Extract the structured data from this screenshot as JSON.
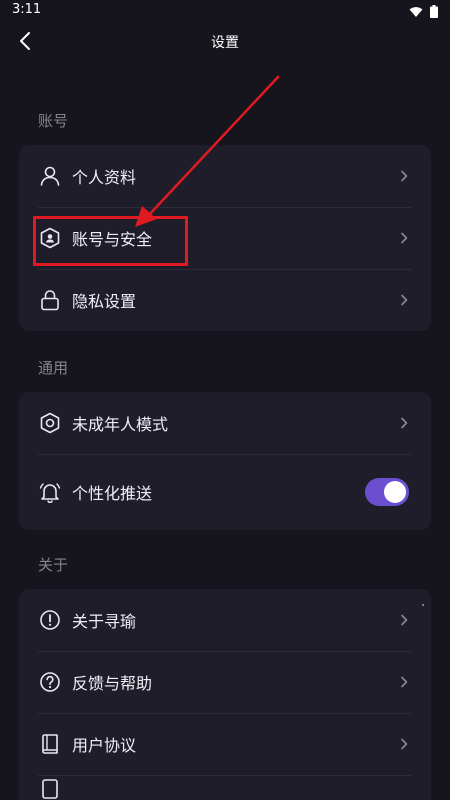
{
  "status_bar": {
    "time": "3:11"
  },
  "header": {
    "title": "设置"
  },
  "sections": {
    "account": {
      "label": "账号",
      "items": [
        "个人资料",
        "账号与安全",
        "隐私设置"
      ]
    },
    "general": {
      "label": "通用",
      "items": [
        "未成年人模式",
        "个性化推送"
      ],
      "push_enabled": true
    },
    "about": {
      "label": "关于",
      "items": [
        "关于寻瑜",
        "反馈与帮助",
        "用户协议"
      ]
    }
  },
  "colors": {
    "background": "#16141d",
    "card": "#201d2b",
    "accent": "#6a4fd0",
    "annotation": "#e01a22"
  },
  "icons": [
    "back-icon",
    "wifi-icon",
    "battery-icon",
    "person-icon",
    "shield-user-icon",
    "lock-icon",
    "hexagon-shield-icon",
    "bell-icon",
    "info-icon",
    "question-icon",
    "book-icon",
    "chevron-right-icon"
  ]
}
